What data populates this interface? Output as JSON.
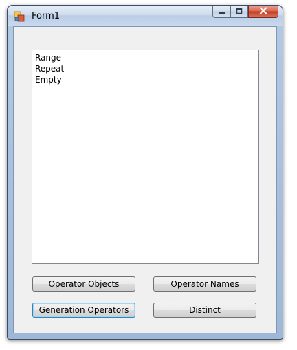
{
  "window": {
    "title": "Form1",
    "close_label": "x"
  },
  "listbox": {
    "items": [
      "Range",
      "Repeat",
      "Empty"
    ]
  },
  "buttons": {
    "operator_objects": "Operator Objects",
    "operator_names": "Operator Names",
    "generation_operators": "Generation Operators",
    "distinct": "Distinct"
  },
  "icons": {
    "app": "form-app-icon",
    "minimize": "minimize-icon",
    "maximize": "maximize-icon",
    "close": "close-icon"
  },
  "colors": {
    "client_bg": "#f0f0f0",
    "close_button": "#c2391f",
    "focus_border": "#3c7fb1"
  }
}
